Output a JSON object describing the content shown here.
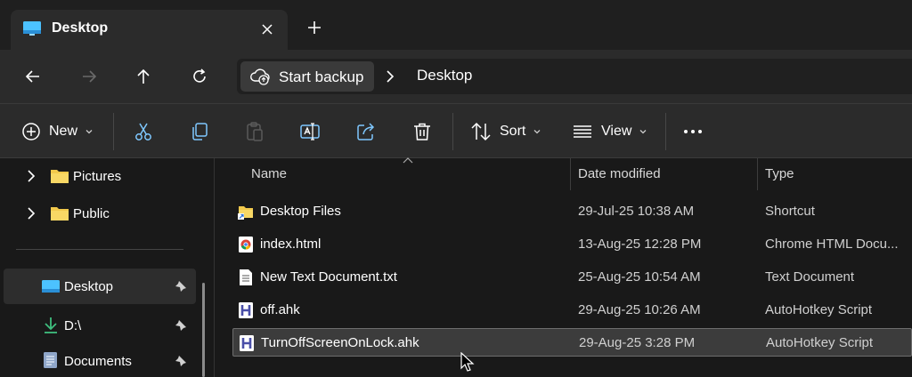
{
  "window": {
    "tab_title": "Desktop",
    "tab_icon": "desktop-folder-icon",
    "close_icon": "close-icon",
    "new_tab_icon": "plus-icon"
  },
  "nav": {
    "back_icon": "arrow-left-icon",
    "forward_icon": "arrow-right-icon",
    "up_icon": "arrow-up-icon",
    "refresh_icon": "refresh-icon",
    "backup_label": "Start backup",
    "breadcrumb_current": "Desktop"
  },
  "toolbar": {
    "new_label": "New",
    "sort_label": "Sort",
    "view_label": "View",
    "more_icon": "more-icon"
  },
  "sidebar": {
    "items": [
      {
        "label": "Pictures",
        "icon": "folder-icon"
      },
      {
        "label": "Public",
        "icon": "folder-icon"
      },
      {
        "label": "Desktop",
        "icon": "desktop-folder-icon",
        "pinned": true,
        "selected": true
      },
      {
        "label": "D:\\",
        "icon": "download-icon",
        "pinned": true
      },
      {
        "label": "Documents",
        "icon": "documents-icon",
        "pinned": true
      }
    ]
  },
  "files": {
    "columns": {
      "name": "Name",
      "date": "Date modified",
      "type": "Type"
    },
    "rows": [
      {
        "name": "Desktop Files",
        "date": "29-Jul-25 10:38 AM",
        "type": "Shortcut",
        "icon": "folder-shortcut-icon"
      },
      {
        "name": "index.html",
        "date": "13-Aug-25 12:28 PM",
        "type": "Chrome HTML Docu...",
        "icon": "chrome-icon"
      },
      {
        "name": "New Text Document.txt",
        "date": "25-Aug-25 10:54 AM",
        "type": "Text Document",
        "icon": "text-file-icon"
      },
      {
        "name": "off.ahk",
        "date": "29-Aug-25 10:26 AM",
        "type": "AutoHotkey Script",
        "icon": "autohotkey-icon"
      },
      {
        "name": "TurnOffScreenOnLock.ahk",
        "date": "29-Aug-25 3:28 PM",
        "type": "AutoHotkey Script",
        "icon": "autohotkey-icon",
        "selected": true
      }
    ]
  },
  "colors": {
    "background": "#191919",
    "toolbar": "#2b2b2b",
    "folder": "#f2c94c",
    "accent": "#4cc2ff",
    "ahk": "#4a4fa8"
  }
}
